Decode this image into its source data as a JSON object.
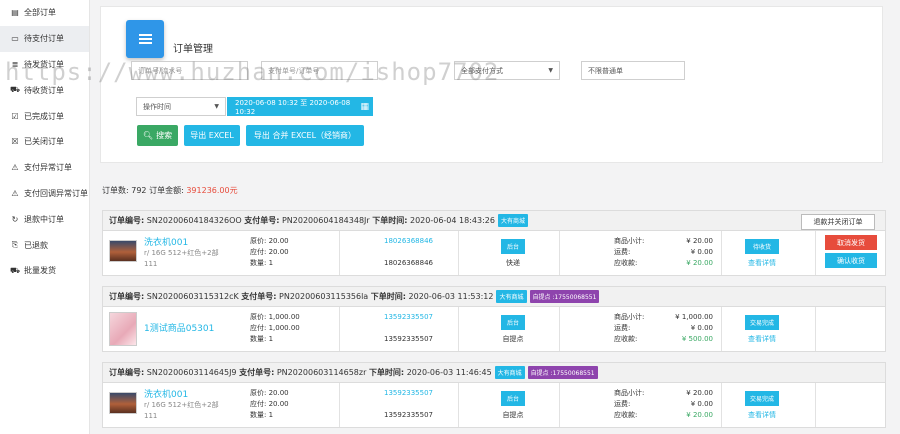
{
  "sidebar": {
    "items": [
      {
        "label": "全部订单",
        "icon": "file-icon"
      },
      {
        "label": "待支付订单",
        "icon": "card-icon"
      },
      {
        "label": "待发货订单",
        "icon": "list-icon"
      },
      {
        "label": "待收货订单",
        "icon": "truck-icon"
      },
      {
        "label": "已完成订单",
        "icon": "check-icon"
      },
      {
        "label": "已关闭订单",
        "icon": "close-box-icon"
      },
      {
        "label": "支付异常订单",
        "icon": "warning-icon"
      },
      {
        "label": "支付回调异常订单",
        "icon": "callback-icon"
      },
      {
        "label": "退款中订单",
        "icon": "refresh-icon"
      },
      {
        "label": "已退款",
        "icon": "refund-icon"
      },
      {
        "label": "批量发货",
        "icon": "shipment-icon"
      }
    ]
  },
  "panel": {
    "title": "订单管理",
    "filters": {
      "order_no_placeholder": "订单号/流水号",
      "pay_no_placeholder": "支付单号/订单号",
      "pay_method": "全部支付方式",
      "order_type": "不限普通单"
    },
    "time_select": "操作时间",
    "date_range": "2020-06-08 10:32 至 2020-06-08 10:32",
    "buttons": {
      "search": "搜索",
      "export": "导出 EXCEL",
      "export_merge": "导出 合并 EXCEL（经销商）"
    }
  },
  "summary": {
    "count_label": "订单数:",
    "count": "792",
    "amount_label": "订单金额:",
    "amount": "391236.00",
    "amount_unit": "元"
  },
  "orders": [
    {
      "head": {
        "order_no_label": "订单编号:",
        "order_no": "SN20200604184326OO",
        "pay_no_label": "支付单号:",
        "pay_no": "PN20200604184348Jr",
        "time_label": "下单时间:",
        "time": "2020-06-04 18:43:26",
        "tags": [
          {
            "text": "大有商城",
            "color": "#23b7e5"
          }
        ],
        "close_btn": "退款并关闭订单"
      },
      "product": {
        "name": "洗衣机001",
        "spec": "r/ 16G 512+红色+2部",
        "spec2": "111"
      },
      "prices": {
        "orig": "原价: 20.00",
        "pay": "应付: 20.00",
        "qty": "数量: 1"
      },
      "phones": {
        "p1": "18026368846",
        "p2": "18026368846"
      },
      "source": {
        "badge": "后台",
        "text": "快递"
      },
      "money": {
        "subtotal_label": "商品小计:",
        "subtotal": "¥ 20.00",
        "freight_label": "运费:",
        "freight": "¥ 0.00",
        "receivable_label": "应收款:",
        "receivable": "¥ 20.00"
      },
      "status": {
        "badge": "待收货",
        "link": "查看详情"
      },
      "actions": [
        {
          "text": "取消发货",
          "color": "#e74c3c"
        },
        {
          "text": "确认收货",
          "color": "#23b7e5"
        }
      ]
    },
    {
      "head": {
        "order_no_label": "订单编号:",
        "order_no": "SN20200603115312cK",
        "pay_no_label": "支付单号:",
        "pay_no": "PN20200603115356la",
        "time_label": "下单时间:",
        "time": "2020-06-03 11:53:12",
        "tags": [
          {
            "text": "大有商城",
            "color": "#23b7e5"
          },
          {
            "text": "自提点 :17550068551",
            "color": "#8e44ad"
          }
        ],
        "close_btn": ""
      },
      "product": {
        "name": "1测试商品05301",
        "spec": "",
        "spec2": ""
      },
      "prices": {
        "orig": "原价: 1,000.00",
        "pay": "应付: 1,000.00",
        "qty": "数量: 1"
      },
      "phones": {
        "p1": "13592335507",
        "p2": "13592335507"
      },
      "source": {
        "badge": "后台",
        "text": "自提点"
      },
      "money": {
        "subtotal_label": "商品小计:",
        "subtotal": "¥ 1,000.00",
        "freight_label": "运费:",
        "freight": "¥ 0.00",
        "receivable_label": "应收款:",
        "receivable": "¥ 500.00"
      },
      "status": {
        "badge": "交易完成",
        "link": "查看详情"
      },
      "actions": []
    },
    {
      "head": {
        "order_no_label": "订单编号:",
        "order_no": "SN20200603114645J9",
        "pay_no_label": "支付单号:",
        "pay_no": "PN20200603114658zr",
        "time_label": "下单时间:",
        "time": "2020-06-03 11:46:45",
        "tags": [
          {
            "text": "大有商城",
            "color": "#23b7e5"
          },
          {
            "text": "自提点 :17550068551",
            "color": "#8e44ad"
          }
        ],
        "close_btn": ""
      },
      "product": {
        "name": "洗衣机001",
        "spec": "r/ 16G 512+红色+2部",
        "spec2": "111"
      },
      "prices": {
        "orig": "原价: 20.00",
        "pay": "应付: 20.00",
        "qty": "数量: 1"
      },
      "phones": {
        "p1": "13592335507",
        "p2": "13592335507"
      },
      "source": {
        "badge": "后台",
        "text": "自提点"
      },
      "money": {
        "subtotal_label": "商品小计:",
        "subtotal": "¥ 20.00",
        "freight_label": "运费:",
        "freight": "¥ 0.00",
        "receivable_label": "应收款:",
        "receivable": "¥ 20.00"
      },
      "status": {
        "badge": "交易完成",
        "link": "查看详情"
      },
      "actions": []
    }
  ],
  "watermark": "https://www.huzhan.com/ishop7702",
  "colors": {
    "accent": "#23b7e5",
    "green": "#3aa864",
    "red": "#e74c3c",
    "purple": "#8e44ad"
  }
}
